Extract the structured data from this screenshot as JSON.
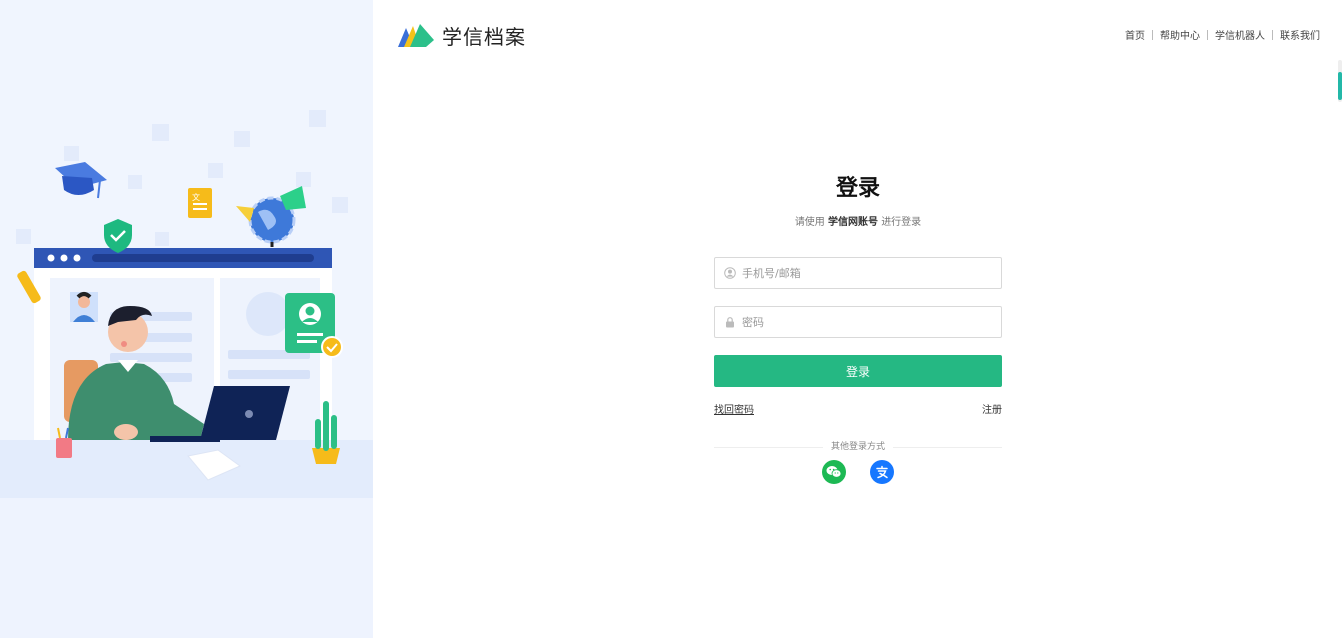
{
  "brand": {
    "name": "学信档案"
  },
  "nav": {
    "items": [
      {
        "label": "首页"
      },
      {
        "label": "帮助中心"
      },
      {
        "label": "学信机器人"
      },
      {
        "label": "联系我们"
      }
    ]
  },
  "login": {
    "title": "登录",
    "subtitle_prefix": "请使用",
    "subtitle_account": "学信网账号",
    "subtitle_suffix": "进行登录",
    "phone_placeholder": "手机号/邮箱",
    "password_placeholder": "密码",
    "submit_label": "登录",
    "forgot_label": "找回密码",
    "register_label": "注册",
    "other_methods_label": "其他登录方式"
  },
  "social_logins": [
    {
      "icon": "wechat-icon",
      "color": "#1db954"
    },
    {
      "icon": "alipay-icon",
      "color": "#1677ff"
    }
  ],
  "colors": {
    "primary": "#25b883",
    "panel_bg": "#f0f5fe",
    "scroll_thumb": "#23b8a8"
  }
}
